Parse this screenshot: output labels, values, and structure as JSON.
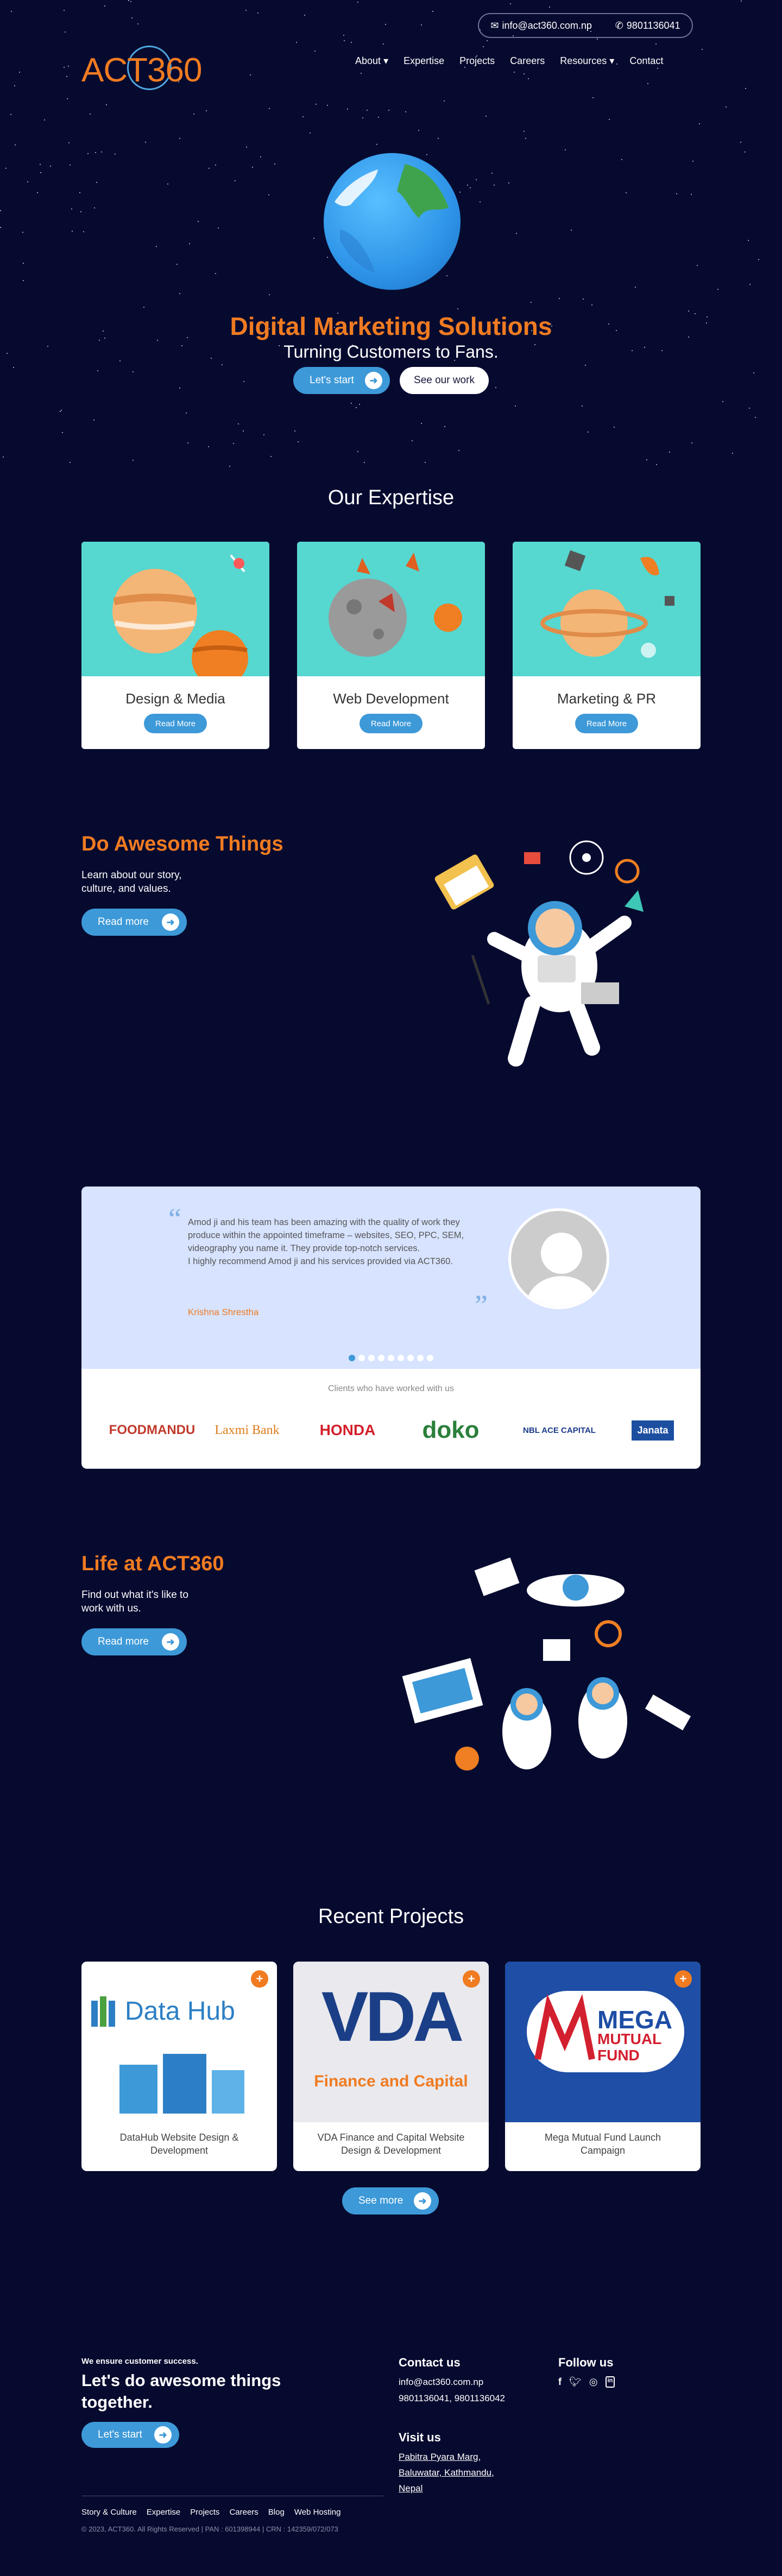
{
  "header": {
    "email": "info@act360.com.np",
    "phone": "9801136041",
    "logo": "ACT360",
    "nav": [
      "About",
      "Expertise",
      "Projects",
      "Careers",
      "Resources",
      "Contact"
    ]
  },
  "hero": {
    "title": "Digital Marketing Solutions",
    "subtitle": "Turning Customers to Fans.",
    "primary_button": "Let's start",
    "secondary_button": "See our work"
  },
  "expertise": {
    "title": "Our Expertise",
    "cards": [
      {
        "name": "Design & Media",
        "button": "Read More"
      },
      {
        "name": "Web Development",
        "button": "Read More"
      },
      {
        "name": "Marketing & PR",
        "button": "Read More"
      }
    ]
  },
  "awesome": {
    "title": "Do Awesome Things",
    "text": "Learn about our story, culture, and values.",
    "button": "Read more"
  },
  "testimonial": {
    "quote": "Amod ji and his team has been amazing with the quality of work they produce within the appointed timeframe – websites, SEO, PPC, SEM, videography you name it. They provide top-notch services.\nI highly recommend Amod ji and his services provided via ACT360.",
    "author": "Krishna Shrestha",
    "clients_label": "Clients who have worked with us",
    "clients": [
      "FOODMANDU",
      "Laxmi Bank",
      "HONDA",
      "doko",
      "NBL ACE CAPITAL",
      "Janata"
    ]
  },
  "life": {
    "title": "Life at ACT360",
    "text": "Find out what it's like to work with us.",
    "button": "Read more"
  },
  "projects": {
    "title": "Recent Projects",
    "items": [
      {
        "caption": "DataHub Website Design & Development",
        "logo_text": "Data Hub"
      },
      {
        "caption": "VDA Finance and Capital Website Design & Development",
        "logo_text": "VDA",
        "logo_sub": "Finance and Capital"
      },
      {
        "caption": "Mega Mutual Fund Launch Campaign",
        "logo_text": "MEGA",
        "logo_sub": "MUTUAL FUND"
      }
    ],
    "button": "See more"
  },
  "footer": {
    "kicker": "We ensure customer success.",
    "headline": "Let's do awesome things together.",
    "button": "Let's start",
    "contact_title": "Contact us",
    "contact_email": "info@act360.com.np",
    "contact_phone": "9801136041, 9801136042",
    "visit_title": "Visit us",
    "address": "Pabitra Pyara Marg, Baluwatar, Kathmandu, Nepal",
    "follow_title": "Follow us",
    "social_icons": [
      "facebook-icon",
      "twitter-icon",
      "instagram-icon",
      "linkedin-icon"
    ],
    "links": [
      "Story & Culture",
      "Expertise",
      "Projects",
      "Careers",
      "Blog",
      "Web Hosting"
    ],
    "copyright": "© 2023, ACT360. All Rights Reserved | PAN : 601398944 | CRN : 142359/072/073"
  },
  "colors": {
    "background": "#070a2f",
    "accent_orange": "#f07b21",
    "accent_blue": "#3d99d8",
    "testimonial_bg": "#d7e3ff"
  }
}
